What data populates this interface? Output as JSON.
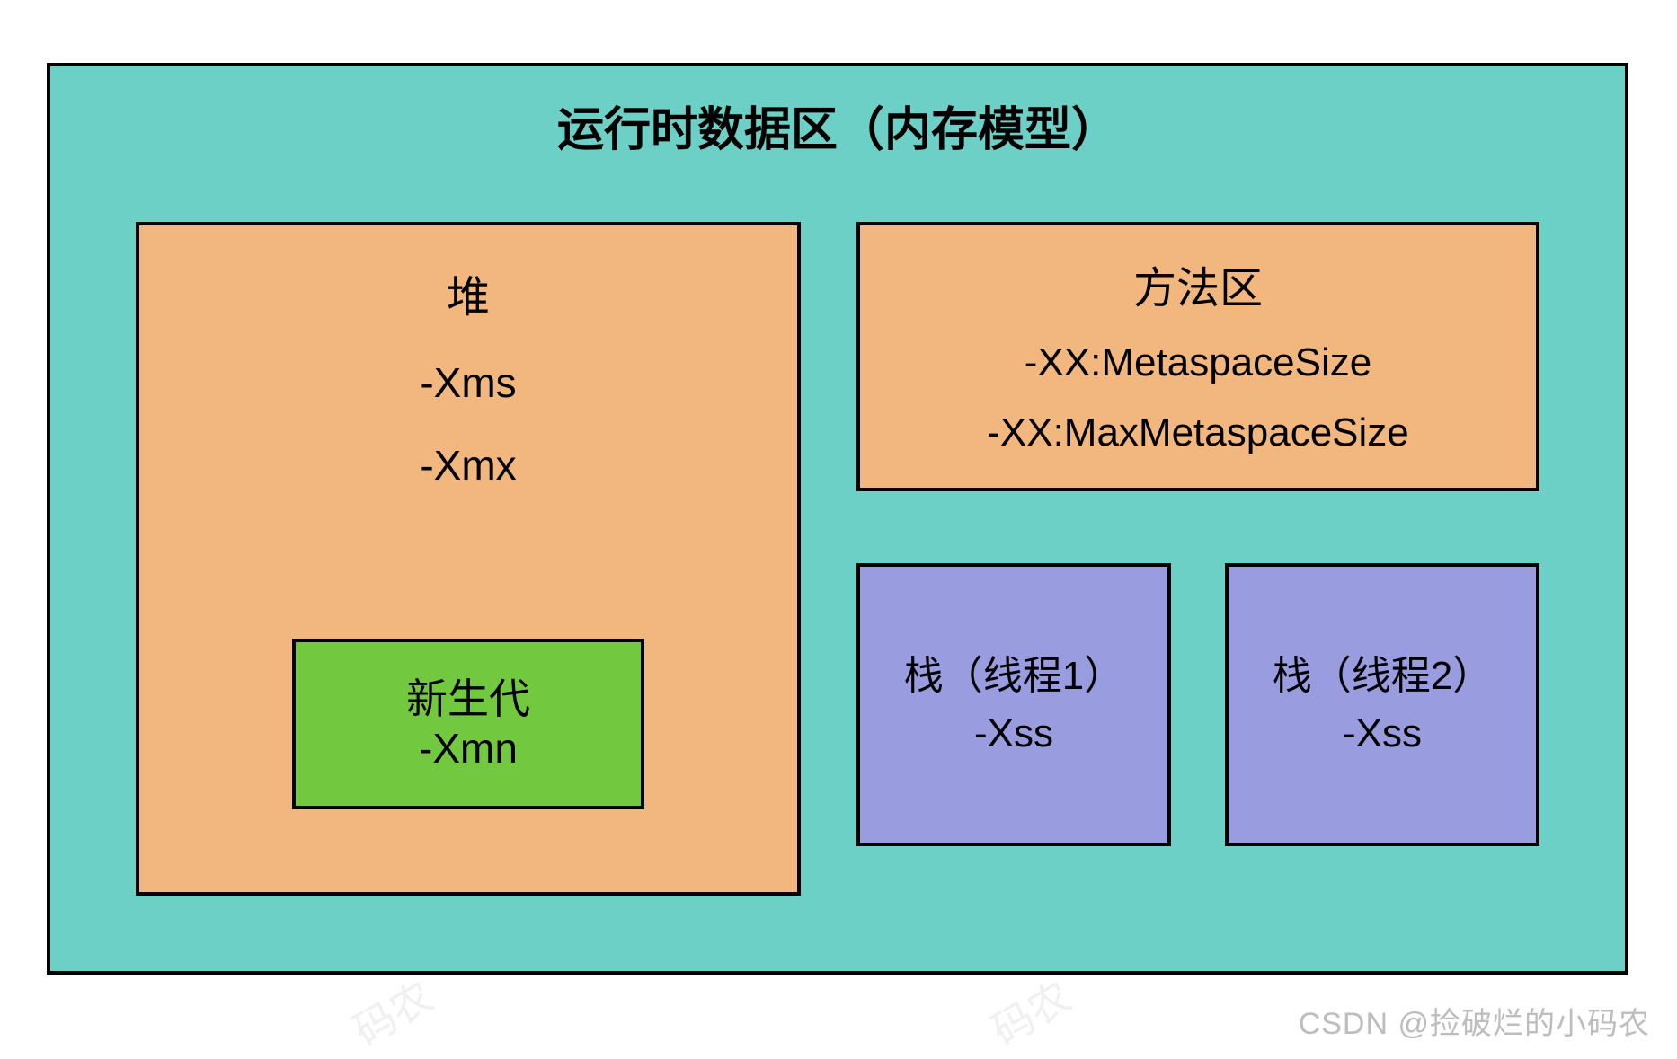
{
  "title": "运行时数据区（内存模型）",
  "heap": {
    "label": "堆",
    "xms": "-Xms",
    "xmx": "-Xmx",
    "young": {
      "label": "新生代",
      "xmn": "-Xmn"
    }
  },
  "method_area": {
    "label": "方法区",
    "meta": "-XX:MetaspaceSize",
    "max_meta": "-XX:MaxMetaspaceSize"
  },
  "stacks": [
    {
      "label": "栈（线程1）",
      "xss": "-Xss"
    },
    {
      "label": "栈（线程2）",
      "xss": "-Xss"
    }
  ],
  "watermark": {
    "main": "CSDN @捡破烂的小码农",
    "bg": "码农"
  },
  "colors": {
    "container_bg": "#6dd0c7",
    "heap_bg": "#f2b77f",
    "method_bg": "#f2b77f",
    "young_bg": "#72c940",
    "stack_bg": "#9a9ce0",
    "border": "#000000"
  }
}
